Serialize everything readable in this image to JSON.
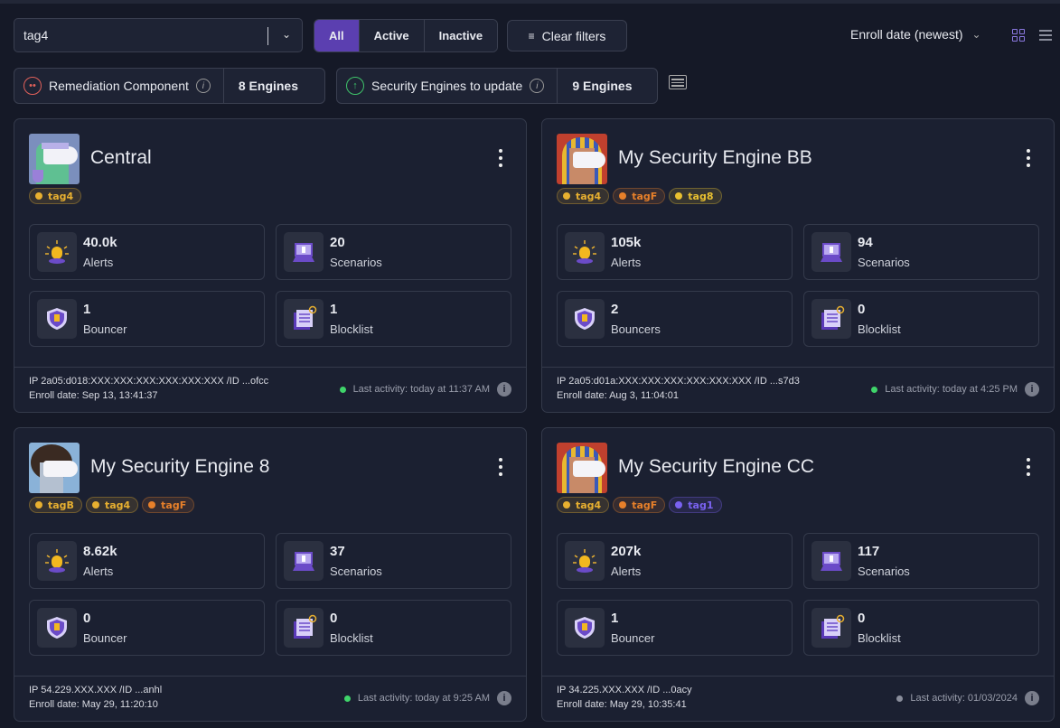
{
  "filters": {
    "tag_select": "tag4",
    "segments": [
      {
        "label": "All",
        "active": true
      },
      {
        "label": "Active",
        "active": false
      },
      {
        "label": "Inactive",
        "active": false
      }
    ],
    "clear_label": "Clear filters",
    "sort_label": "Enroll date (newest)"
  },
  "summary": [
    {
      "label": "Remediation Component",
      "value": "8 Engines",
      "icon": "neutral-face-icon",
      "color": "#e0605a"
    },
    {
      "label": "Security Engines to update",
      "value": "9 Engines",
      "icon": "arrow-up-circle-icon",
      "color": "#3fc46a"
    }
  ],
  "tag_colors": {
    "tag4": "#e8b030",
    "tagF": "#e8802a",
    "tag8": "#e8c030",
    "tagB": "#e8b030",
    "tag1": "#7a62f0"
  },
  "engines": [
    {
      "name": "Central",
      "avatar": "scientist",
      "tags": [
        "tag4"
      ],
      "stats": [
        {
          "value": "40.0k",
          "label": "Alerts",
          "icon": "alert-light-icon"
        },
        {
          "value": "20",
          "label": "Scenarios",
          "icon": "laptop-icon"
        },
        {
          "value": "1",
          "label": "Bouncer",
          "icon": "shield-icon"
        },
        {
          "value": "1",
          "label": "Blocklist",
          "icon": "blocklist-icon"
        }
      ],
      "ip": "IP 2a05:d018:XXX:XXX:XXX:XXX:XXX:XXX /ID ...ofcc",
      "enroll": "Enroll date: Sep 13, 13:41:37",
      "activity": "Last activity: today at 11:37 AM",
      "status_color": "#3fd46a"
    },
    {
      "name": "My Security Engine BB",
      "avatar": "pharaoh",
      "tags": [
        "tag4",
        "tagF",
        "tag8"
      ],
      "stats": [
        {
          "value": "105k",
          "label": "Alerts",
          "icon": "alert-light-icon"
        },
        {
          "value": "94",
          "label": "Scenarios",
          "icon": "laptop-icon"
        },
        {
          "value": "2",
          "label": "Bouncers",
          "icon": "shield-icon"
        },
        {
          "value": "0",
          "label": "Blocklist",
          "icon": "blocklist-icon"
        }
      ],
      "ip": "IP 2a05:d01a:XXX:XXX:XXX:XXX:XXX:XXX /ID ...s7d3",
      "enroll": "Enroll date: Aug 3, 11:04:01",
      "activity": "Last activity: today at 4:25 PM",
      "status_color": "#3fd46a"
    },
    {
      "name": "My Security Engine 8",
      "avatar": "afro",
      "tags": [
        "tagB",
        "tag4",
        "tagF"
      ],
      "stats": [
        {
          "value": "8.62k",
          "label": "Alerts",
          "icon": "alert-light-icon"
        },
        {
          "value": "37",
          "label": "Scenarios",
          "icon": "laptop-icon"
        },
        {
          "value": "0",
          "label": "Bouncer",
          "icon": "shield-icon"
        },
        {
          "value": "0",
          "label": "Blocklist",
          "icon": "blocklist-icon"
        }
      ],
      "ip": "IP 54.229.XXX.XXX /ID ...anhl",
      "enroll": "Enroll date: May 29, 11:20:10",
      "activity": "Last activity: today at 9:25 AM",
      "status_color": "#3fd46a"
    },
    {
      "name": "My Security Engine CC",
      "avatar": "pharaoh",
      "tags": [
        "tag4",
        "tagF",
        "tag1"
      ],
      "stats": [
        {
          "value": "207k",
          "label": "Alerts",
          "icon": "alert-light-icon"
        },
        {
          "value": "117",
          "label": "Scenarios",
          "icon": "laptop-icon"
        },
        {
          "value": "1",
          "label": "Bouncer",
          "icon": "shield-icon"
        },
        {
          "value": "0",
          "label": "Blocklist",
          "icon": "blocklist-icon"
        }
      ],
      "ip": "IP 34.225.XXX.XXX /ID ...0acy",
      "enroll": "Enroll date: May 29, 10:35:41",
      "activity": "Last activity: 01/03/2024",
      "status_color": "#8a8e9c"
    }
  ]
}
